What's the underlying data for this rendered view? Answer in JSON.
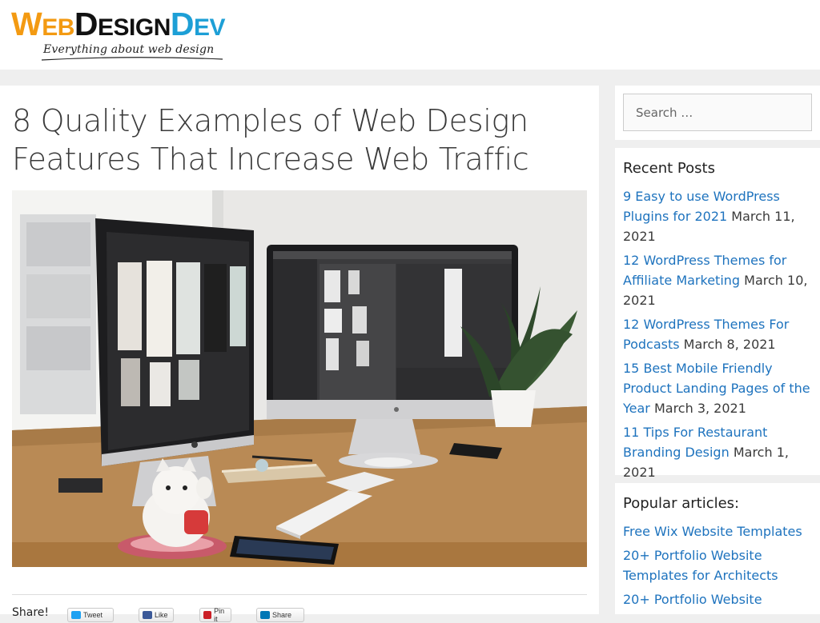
{
  "header": {
    "logo": {
      "part1_initial": "W",
      "part1_rest": "EB",
      "part2_initial": "D",
      "part2_rest": "ESIGN",
      "part3_initial": "D",
      "part3_rest": "EV",
      "tagline": "Everything about web design"
    }
  },
  "article": {
    "title": "8 Quality Examples of Web Design Features That Increase Web Traffic",
    "share": {
      "label": "Share!",
      "buttons": [
        {
          "label": "Tweet",
          "icon": "twitter-icon",
          "color": "#1da1f2"
        },
        {
          "label": "Like",
          "icon": "facebook-icon",
          "color": "#3b5998"
        },
        {
          "label": "Pin it",
          "icon": "pinterest-icon",
          "color": "#cb2027"
        },
        {
          "label": "Share",
          "icon": "linkedin-icon",
          "color": "#0077b5"
        }
      ]
    }
  },
  "sidebar": {
    "search": {
      "placeholder": "Search …"
    },
    "recent_posts": {
      "title": "Recent Posts",
      "items": [
        {
          "link": "9 Easy to use WordPress Plugins for 2021",
          "date": "March 11, 2021"
        },
        {
          "link": "12 WordPress Themes for Affiliate Marketing",
          "date": "March 10, 2021"
        },
        {
          "link": "12 WordPress Themes For Podcasts",
          "date": "March 8, 2021"
        },
        {
          "link": "15 Best Mobile Friendly Product Landing Pages of the Year",
          "date": "March 3, 2021"
        },
        {
          "link": "11 Tips For Restaurant Branding Design",
          "date": "March 1, 2021"
        }
      ]
    },
    "popular": {
      "title": "Popular articles:",
      "items": [
        {
          "link": "Free Wix Website Templates"
        },
        {
          "link": "20+ Portfolio Website Templates for Architects"
        },
        {
          "link": "20+ Portfolio Website"
        }
      ]
    }
  },
  "colors": {
    "link": "#1e73be",
    "logo_orange": "#f39a12",
    "logo_blue": "#1d9fd6",
    "background": "#efefef"
  }
}
